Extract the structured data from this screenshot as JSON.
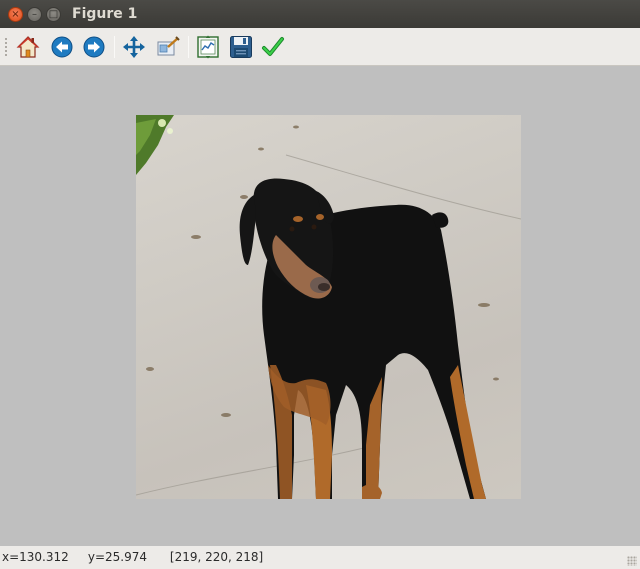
{
  "window": {
    "title": "Figure 1",
    "close_glyph": "×",
    "minimize_glyph": "–",
    "maximize_glyph": "□"
  },
  "toolbar": {
    "tools": [
      {
        "name": "home-icon"
      },
      {
        "name": "back-icon"
      },
      {
        "name": "forward-icon"
      },
      {
        "name": "pan-icon"
      },
      {
        "name": "zoom-icon"
      },
      {
        "name": "subplots-icon"
      },
      {
        "name": "save-icon"
      },
      {
        "name": "edit-axis-icon"
      }
    ]
  },
  "colors": {
    "titlebar": "#3f3e3a",
    "toolbar": "#edebe8",
    "canvas": "#bfbfbf",
    "accent_blue": "#1f7bc1",
    "check_green": "#3bb54a"
  },
  "figure": {
    "image_subject": "doberman-dog-photo"
  },
  "status": {
    "text": "x=130.312     y=25.974      [219, 220, 218]"
  }
}
